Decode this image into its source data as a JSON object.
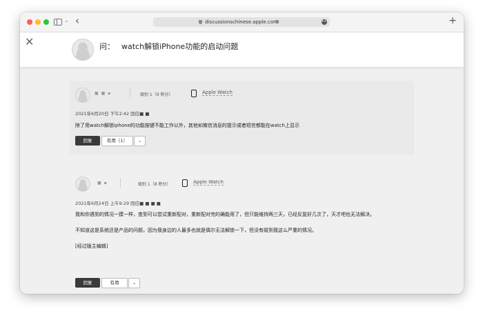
{
  "browser": {
    "url": "discussionschinese.apple.com"
  },
  "question": {
    "prefix": "问：",
    "title": "watch解锁iPhone功能的启动问题"
  },
  "replies": [
    {
      "author_blurred": "■ ■ ▪",
      "level": "级别 1（9 积分）",
      "device": "Apple Watch",
      "timestamp": "2021年6月20日 下午2:42 回应■ ■",
      "paragraphs": [
        "除了用watch解锁iphone的功能按键不能工作以外，其他如微信消息的提示或者短信都能在watch上显示"
      ],
      "reply_label": "回复",
      "helpful_label": "有用（1）"
    },
    {
      "author_blurred": "■ ▪",
      "level": "级别 1（8 积分）",
      "device": "Apple Watch",
      "timestamp": "2021年6月24日 上午9:29 回应■ ■ ■ ■",
      "paragraphs": [
        "我和你遇到的情况一摸一样，查到可以尝试重新配对，重新配对完的确能用了，但只能维持两三天，已经反复好几次了，天才吧也无法解决。",
        "不知道这是系统还是产品的问题，因为我身边的人最多也就是偶尔无法解锁一下，但没有碰到我这么严重的情况。",
        "[经过版主编辑]"
      ],
      "reply_label": "回复",
      "helpful_label": "有用"
    }
  ]
}
